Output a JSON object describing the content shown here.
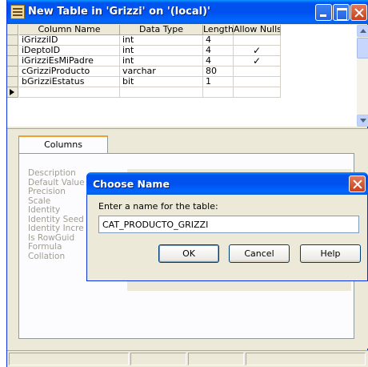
{
  "window": {
    "title": "New Table in 'Grizzi' on '(local)'"
  },
  "grid": {
    "headers": [
      "Column Name",
      "Data Type",
      "Length",
      "Allow Nulls"
    ],
    "rows": [
      {
        "name": "iGrizziID",
        "type": "int",
        "length": "4",
        "allow_nulls": ""
      },
      {
        "name": "iDeptoID",
        "type": "int",
        "length": "4",
        "allow_nulls": "✓"
      },
      {
        "name": "iGrizziEsMiPadre",
        "type": "int",
        "length": "4",
        "allow_nulls": "✓"
      },
      {
        "name": "cGrizziProducto",
        "type": "varchar",
        "length": "80",
        "allow_nulls": ""
      },
      {
        "name": "bGrizziEstatus",
        "type": "bit",
        "length": "1",
        "allow_nulls": ""
      }
    ]
  },
  "properties": {
    "tab_label": "Columns",
    "items": [
      "Description",
      "Default Value",
      "Precision",
      "Scale",
      "Identity",
      "Identity Seed",
      "Identity Incre",
      "Is RowGuid",
      "Formula",
      "Collation"
    ]
  },
  "dialog": {
    "title": "Choose Name",
    "prompt": "Enter a name for the table:",
    "input_value": "CAT_PRODUCTO_GRIZZI",
    "ok_label": "OK",
    "cancel_label": "Cancel",
    "help_label": "Help"
  }
}
